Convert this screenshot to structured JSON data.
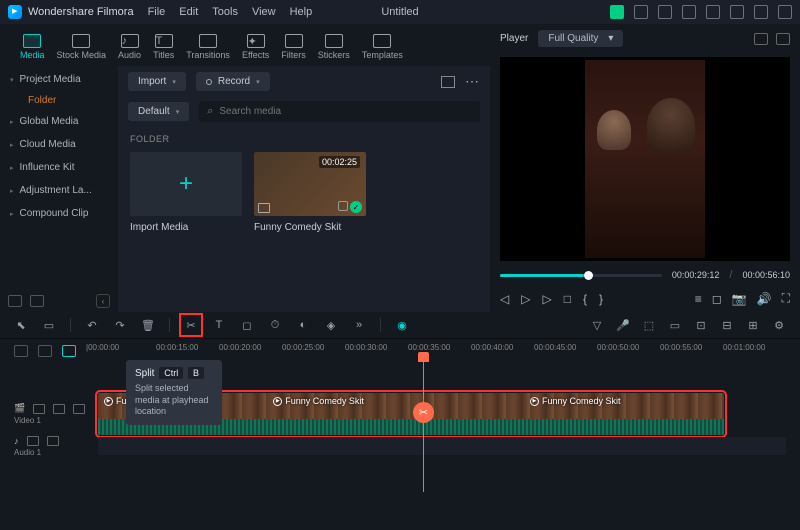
{
  "app": {
    "name": "Wondershare Filmora",
    "title": "Untitled"
  },
  "menu": [
    "File",
    "Edit",
    "Tools",
    "View",
    "Help"
  ],
  "categories": [
    {
      "label": "Media",
      "active": true
    },
    {
      "label": "Stock Media"
    },
    {
      "label": "Audio"
    },
    {
      "label": "Titles"
    },
    {
      "label": "Transitions"
    },
    {
      "label": "Effects"
    },
    {
      "label": "Filters"
    },
    {
      "label": "Stickers"
    },
    {
      "label": "Templates"
    }
  ],
  "tree": {
    "project": "Project Media",
    "folder": "Folder",
    "global": "Global Media",
    "cloud": "Cloud Media",
    "influence": "Influence Kit",
    "adjustment": "Adjustment La...",
    "compound": "Compound Clip"
  },
  "mediaToolbar": {
    "import": "Import",
    "record": "Record",
    "default": "Default",
    "searchPlaceholder": "Search media"
  },
  "folderHeader": "FOLDER",
  "thumbs": {
    "import": "Import Media",
    "clip1": "Funny Comedy Skit",
    "clip1dur": "00:02:25"
  },
  "player": {
    "label": "Player",
    "quality": "Full Quality",
    "current": "00:00:29:12",
    "total": "00:00:56:10"
  },
  "tooltip": {
    "title": "Split",
    "key1": "Ctrl",
    "key2": "B",
    "body": "Split selected media at playhead location"
  },
  "ruler": [
    "|00:00:00",
    "00:00:15:00",
    "00:00:20:00",
    "00:00:25:00",
    "00:00:30:00",
    "00:00:35:00",
    "00:00:40:00",
    "00:00:45:00",
    "00:00:50:00",
    "00:00:55:00",
    "00:01:00:00"
  ],
  "tracks": {
    "video1": "Video 1",
    "audio1": "Audio 1",
    "clipLabel": "Funny Comedy Skit"
  }
}
